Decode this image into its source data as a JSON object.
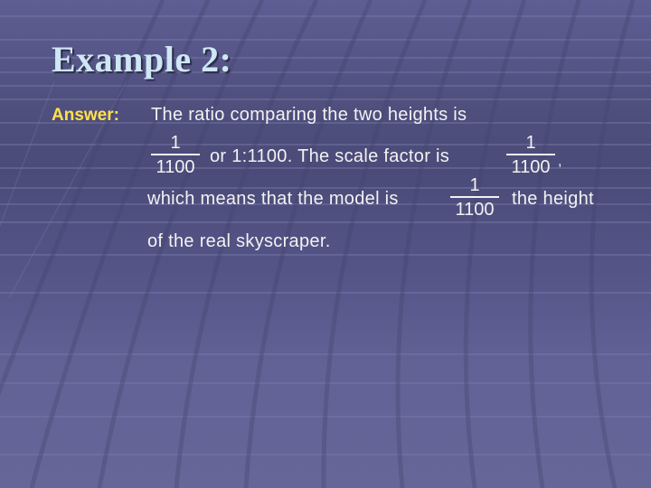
{
  "slide": {
    "title": "Example 2:",
    "answer_label": "Answer:",
    "line1": "The ratio comparing the two heights is",
    "fraction1": {
      "numerator": "1",
      "denominator": "1100"
    },
    "line2_text": "or 1:1100.  The scale factor is",
    "fraction2": {
      "numerator": "1",
      "denominator": "1100"
    },
    "comma": ",",
    "line3_text": "which means that the model is",
    "fraction3": {
      "numerator": "1",
      "denominator": "1100"
    },
    "line3_tail": "the height",
    "line4": "of the real skyscraper."
  },
  "colors": {
    "title": "#cfe6f5",
    "answer_label": "#ffe24a",
    "body_text": "#f2f2f2",
    "background": "#56568a"
  }
}
